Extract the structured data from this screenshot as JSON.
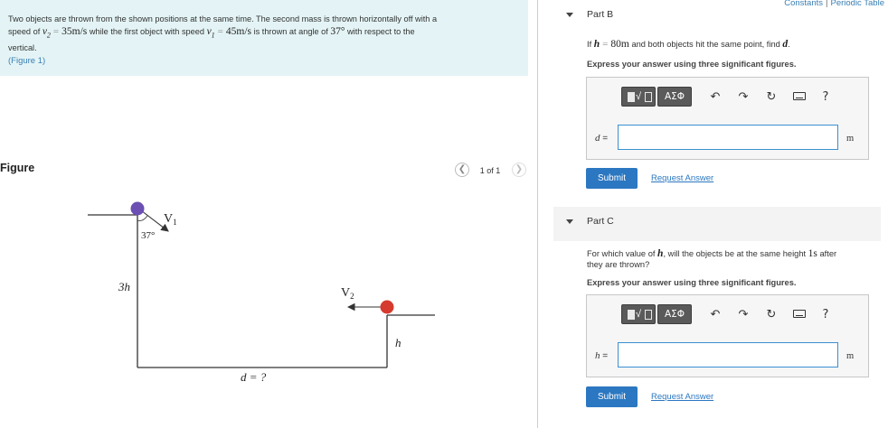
{
  "header": {
    "links": [
      "Constants",
      "Periodic Table"
    ],
    "separator": "|"
  },
  "problem": {
    "line1_a": "Two objects are thrown from the shown positions at the same time. The second mass is thrown horizontally off with a",
    "line2_a": "speed of",
    "v2_symbol": "v",
    "v2_sub": "2",
    "equals": "=",
    "v2_value": "35m/s",
    "line2_b": "while the first object with speed",
    "v1_symbol": "v",
    "v1_sub": "1",
    "v1_value": "45m/s",
    "line2_c": "is thrown at angle of",
    "angle_value": "37°",
    "line2_d": "with respect to the",
    "line3": "vertical.",
    "figure_link": "(Figure 1)"
  },
  "figure": {
    "heading": "Figure",
    "prev_icon": "chevron-left-icon",
    "next_icon": "chevron-right-icon",
    "page_indicator": "1 of 1",
    "labels": {
      "v1": "V",
      "v1_sub": "1",
      "v2": "V",
      "v2_sub": "2",
      "angle": "37°",
      "height_left": "3h",
      "height_right": "h",
      "distance": "d = ?"
    },
    "colors": {
      "ball1": "#6b4fb3",
      "ball2": "#d63a2e",
      "lines": "#333333"
    }
  },
  "partB": {
    "title": "Part B",
    "prompt_a": "If",
    "prompt_var": "h",
    "prompt_eq": "=",
    "prompt_value": "80m",
    "prompt_b": "and both objects hit the same point, find",
    "prompt_find": "d",
    "prompt_end": ".",
    "instruction": "Express your answer using three significant figures.",
    "toolbar": {
      "templates_icon": "templates-icon",
      "greek_label": "ΑΣΦ",
      "undo_icon": "undo-icon",
      "redo_icon": "redo-icon",
      "reset_icon": "reset-icon",
      "keyboard_icon": "keyboard-icon",
      "help_label": "?"
    },
    "variable": "d",
    "variable_eq": " =",
    "answer_value": "",
    "unit": "m",
    "submit_label": "Submit",
    "request_label": "Request Answer"
  },
  "partC": {
    "title": "Part C",
    "prompt_a": "For which value of",
    "prompt_var": "h",
    "prompt_b": ", will the objects be at the same height",
    "prompt_time": "1s",
    "prompt_c": "after",
    "prompt_line2": "they are thrown?",
    "instruction": "Express your answer using three significant figures.",
    "toolbar": {
      "templates_icon": "templates-icon",
      "greek_label": "ΑΣΦ",
      "undo_icon": "undo-icon",
      "redo_icon": "redo-icon",
      "reset_icon": "reset-icon",
      "keyboard_icon": "keyboard-icon",
      "help_label": "?"
    },
    "variable": "h",
    "variable_eq": " =",
    "answer_value": "",
    "unit": "m",
    "submit_label": "Submit",
    "request_label": "Request Answer"
  }
}
